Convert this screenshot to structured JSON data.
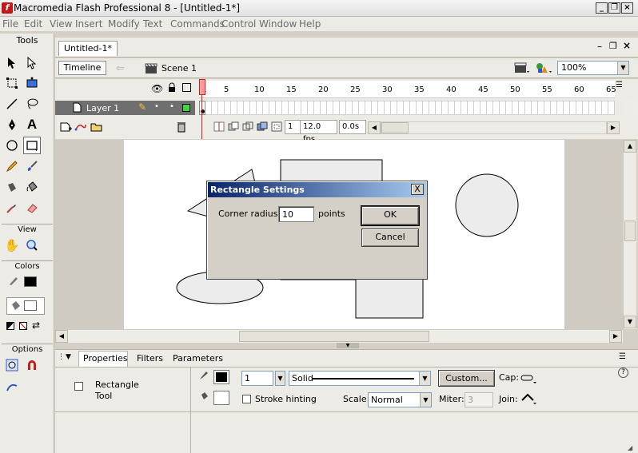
{
  "window": {
    "title": "Macromedia Flash Professional 8 - [Untitled-1*]",
    "logo_letter": "f"
  },
  "menu": [
    "File",
    "Edit",
    "View",
    "Insert",
    "Modify",
    "Text",
    "Commands",
    "Control",
    "Window",
    "Help"
  ],
  "tools": {
    "header": "Tools",
    "view_header": "View",
    "colors_header": "Colors",
    "options_header": "Options",
    "stroke_color": "#000000",
    "fill_color": "#ffffff"
  },
  "document": {
    "tab": "Untitled-1*",
    "timeline_button": "Timeline",
    "scene": "Scene 1",
    "zoom": "100%"
  },
  "timeline": {
    "layer_name": "Layer 1",
    "frame_numbers": [
      "1",
      "5",
      "10",
      "15",
      "20",
      "25",
      "30",
      "35",
      "40",
      "45",
      "50",
      "55",
      "60",
      "65"
    ],
    "current_frame": "1",
    "fps": "12.0 fps",
    "time": "0.0s"
  },
  "dialog": {
    "title": "Rectangle Settings",
    "close": "X",
    "corner_radius_label": "Corner radius:",
    "corner_radius_value": "10",
    "units": "points",
    "ok_label": "OK",
    "cancel_label": "Cancel"
  },
  "properties": {
    "tabs": [
      "Properties",
      "Filters",
      "Parameters"
    ],
    "tool_name": "Rectangle\nTool",
    "tool_name_line1": "Rectangle",
    "tool_name_line2": "Tool",
    "stroke_height": "1",
    "stroke_style": "Solid",
    "custom_label": "Custom...",
    "cap_label": "Cap:",
    "stroke_hinting_label": "Stroke hinting",
    "scale_label": "Scale:",
    "scale_value": "Normal",
    "miter_label": "Miter:",
    "miter_value": "3",
    "join_label": "Join:",
    "help": "?"
  }
}
